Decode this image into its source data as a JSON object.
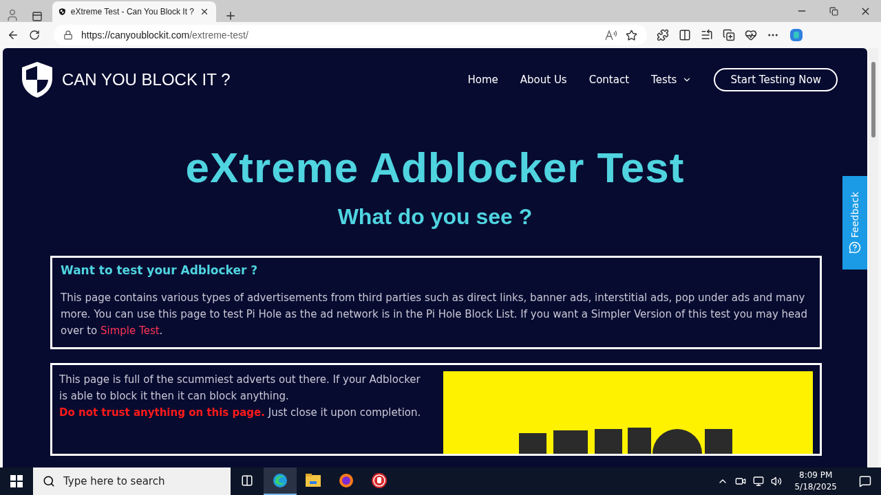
{
  "browser": {
    "tabs": [
      {
        "title": "eXtreme Test - Can You Block It ?",
        "selected": true
      }
    ],
    "url": {
      "host": "https://canyoublockit.com",
      "path": "/extreme-test/"
    }
  },
  "site": {
    "logo": "CAN YOU BLOCK IT ?",
    "nav": [
      {
        "label": "Home",
        "kind": "link"
      },
      {
        "label": "About Us",
        "kind": "link"
      },
      {
        "label": "Contact",
        "kind": "link"
      },
      {
        "label": "Tests",
        "kind": "dropdown"
      }
    ],
    "cta": "Start Testing Now",
    "heading": "eXtreme Adblocker Test",
    "subheading": "What do you see ?",
    "intro_box": {
      "title": "Want to test your Adblocker ?",
      "text_before": "This page contains various types of advertisements from third parties such as direct links, banner ads, interstitial ads, pop under ads and many more. You can use this page to test Pi Hole as the ad network is in the Pi Hole Block List. If you want a Simpler Version of this test you may head over to ",
      "link": "Simple Test",
      "text_after": "."
    },
    "warning_box": {
      "text": "This page is full of the scummiest adverts out there. If your Adblocker is able to block it then it can block anything.",
      "warning": "**Do not trust anything on this page.** Just close it upon completion."
    },
    "feedback": "Feedback"
  },
  "taskbar": {
    "search": {
      "placeholder": "Type here to search"
    },
    "apps": [
      {
        "kind": "edge",
        "selected": true
      },
      {
        "kind": "files",
        "selected": false
      },
      {
        "kind": "firefox",
        "selected": false
      },
      {
        "kind": "stop",
        "selected": false
      }
    ],
    "time": "8:09 PM",
    "date": "5/18/2025"
  }
}
